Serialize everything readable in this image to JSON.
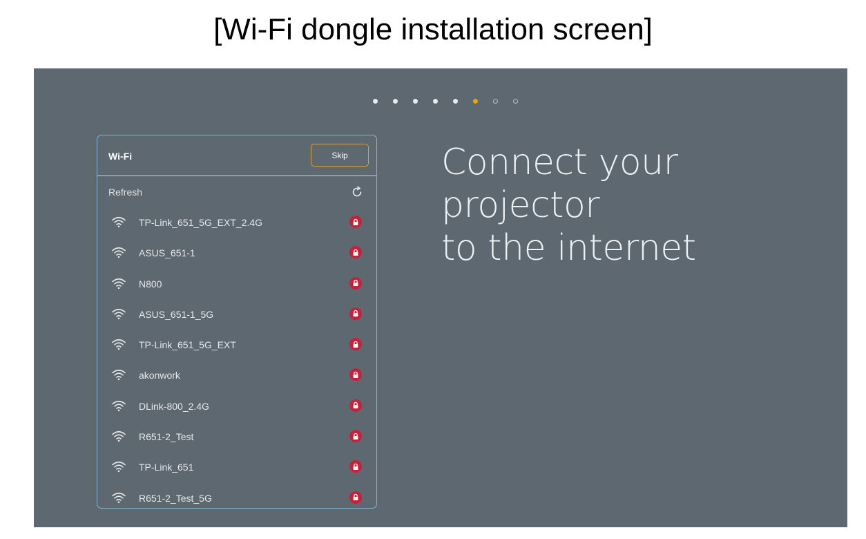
{
  "caption": "[Wi-Fi dongle installation screen]",
  "progress": {
    "total_steps": 8,
    "current_step": 6
  },
  "panel": {
    "title": "Wi-Fi",
    "skip_label": "Skip",
    "refresh_label": "Refresh"
  },
  "networks": [
    {
      "name": "TP-Link_651_5G_EXT_2.4G",
      "secured": true
    },
    {
      "name": "ASUS_651-1",
      "secured": true
    },
    {
      "name": "N800",
      "secured": true
    },
    {
      "name": "ASUS_651-1_5G",
      "secured": true
    },
    {
      "name": "TP-Link_651_5G_EXT",
      "secured": true
    },
    {
      "name": "akonwork",
      "secured": true
    },
    {
      "name": "DLink-800_2.4G",
      "secured": true
    },
    {
      "name": "R651-2_Test",
      "secured": true
    },
    {
      "name": "TP-Link_651",
      "secured": true
    },
    {
      "name": "R651-2_Test_5G",
      "secured": true
    }
  ],
  "headline": {
    "line1": "Connect your projector",
    "line2": "to the internet"
  },
  "colors": {
    "background": "#5d6870",
    "accent": "#f2a400",
    "panel_border": "#7fb6d8",
    "lock": "#c8203a"
  }
}
